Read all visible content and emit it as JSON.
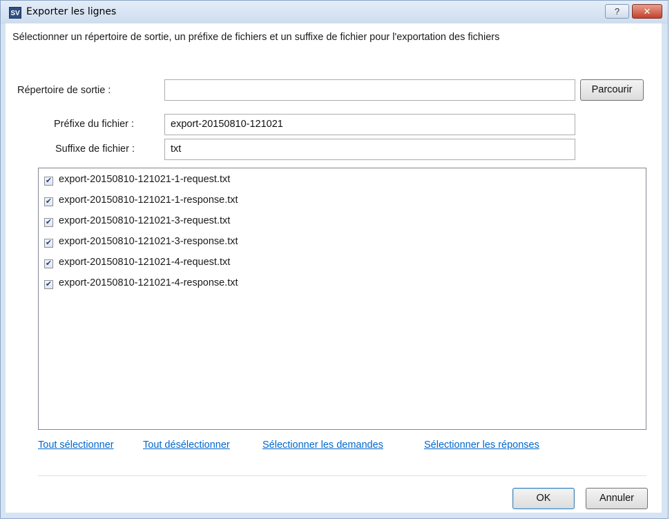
{
  "window": {
    "title": "Exporter les lignes",
    "app_icon_text": "SV",
    "help_label": "?",
    "close_label": "✕"
  },
  "form": {
    "instructions": "Sélectionner un répertoire de sortie, un préfixe de fichiers et un suffixe de fichier pour l'exportation des fichiers",
    "output_dir_label": "Répertoire de sortie :",
    "output_dir_value": "",
    "browse_label": "Parcourir",
    "prefix_label": "Préfixe du fichier :",
    "prefix_value": "export-20150810-121021",
    "suffix_label": "Suffixe de fichier :",
    "suffix_value": "txt"
  },
  "files": [
    {
      "name": "export-20150810-121021-1-request.txt",
      "checked": true
    },
    {
      "name": "export-20150810-121021-1-response.txt",
      "checked": true
    },
    {
      "name": "export-20150810-121021-3-request.txt",
      "checked": true
    },
    {
      "name": "export-20150810-121021-3-response.txt",
      "checked": true
    },
    {
      "name": "export-20150810-121021-4-request.txt",
      "checked": true
    },
    {
      "name": "export-20150810-121021-4-response.txt",
      "checked": true
    }
  ],
  "links": {
    "select_all": "Tout sélectionner",
    "deselect_all": "Tout désélectionner",
    "select_requests": "Sélectionner les demandes",
    "select_responses": "Sélectionner les réponses"
  },
  "buttons": {
    "ok": "OK",
    "cancel": "Annuler"
  },
  "colors": {
    "link": "#0066cc",
    "title_bar": "#d6e4f3",
    "close_button": "#c2412b"
  },
  "icons": {
    "checkbox_mark": "✔"
  }
}
